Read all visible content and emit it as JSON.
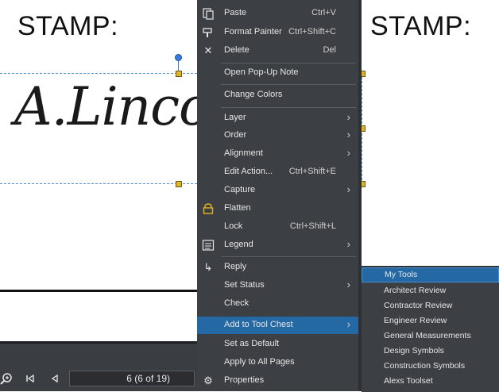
{
  "document": {
    "left_stamp_title": "STAMP:",
    "right_stamp_title": "STAMP:",
    "signature_text": "A.Linco"
  },
  "context_menu": {
    "items": [
      {
        "label": "Paste",
        "shortcut": "Ctrl+V",
        "icon": "paste-icon"
      },
      {
        "label": "Format Painter",
        "shortcut": "Ctrl+Shift+C",
        "icon": "brush-icon"
      },
      {
        "label": "Delete",
        "shortcut": "Del",
        "icon": "close-icon"
      },
      {
        "label": "Open Pop-Up Note"
      },
      {
        "label": "Change Colors"
      },
      {
        "label": "Layer",
        "submenu": true
      },
      {
        "label": "Order",
        "submenu": true
      },
      {
        "label": "Alignment",
        "submenu": true
      },
      {
        "label": "Edit Action...",
        "shortcut": "Ctrl+Shift+E"
      },
      {
        "label": "Capture",
        "submenu": true
      },
      {
        "label": "Flatten",
        "icon": "flatten-icon"
      },
      {
        "label": "Lock",
        "shortcut": "Ctrl+Shift+L"
      },
      {
        "label": "Legend",
        "submenu": true,
        "icon": "legend-icon"
      },
      {
        "label": "Reply",
        "icon": "reply-icon"
      },
      {
        "label": "Set Status",
        "submenu": true
      },
      {
        "label": "Check"
      },
      {
        "label": "Add to Tool Chest",
        "submenu": true
      },
      {
        "label": "Set as Default"
      },
      {
        "label": "Apply to All Pages"
      },
      {
        "label": "Properties",
        "icon": "gear-icon"
      }
    ]
  },
  "tool_chest_submenu": {
    "items": [
      {
        "label": "My Tools"
      },
      {
        "label": "Architect Review"
      },
      {
        "label": "Contractor Review"
      },
      {
        "label": "Engineer Review"
      },
      {
        "label": "General Measurements"
      },
      {
        "label": "Design Symbols"
      },
      {
        "label": "Construction Symbols"
      },
      {
        "label": "Alexs Toolset"
      }
    ],
    "highlighted": "My Tools"
  },
  "navigation": {
    "page_display": "6 (6 of 19)"
  },
  "colors": {
    "menu_bg": "#3c3f43",
    "highlight": "#2569a4",
    "selection_handle": "#e0b325",
    "selection_border": "#5b8fd6"
  }
}
